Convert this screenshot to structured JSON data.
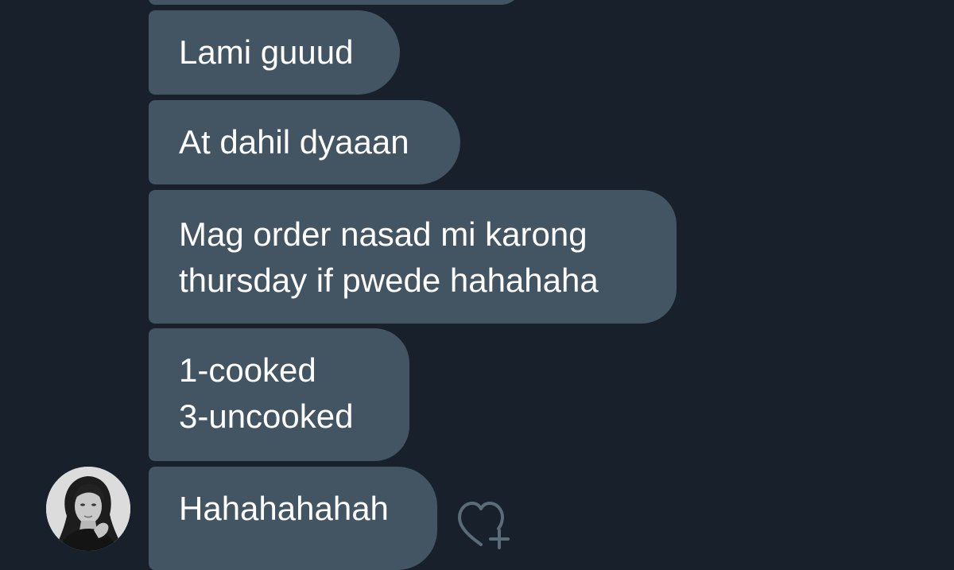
{
  "messages": [
    {
      "lines": [
        ""
      ]
    },
    {
      "lines": [
        "Lami guuud"
      ]
    },
    {
      "lines": [
        "At dahil dyaaan"
      ]
    },
    {
      "lines": [
        "Mag order nasad mi karong",
        "thursday if pwede hahahaha"
      ]
    },
    {
      "lines": [
        "1-cooked",
        "3-uncooked"
      ]
    },
    {
      "lines": [
        "Hahahahahah"
      ]
    }
  ],
  "avatar": {
    "icon": "profile-photo"
  },
  "reaction": {
    "icon": "heart-plus-icon"
  },
  "colors": {
    "background": "#18202b",
    "bubble": "#435463",
    "text": "#ffffff",
    "icon_stroke": "#5c6b78"
  }
}
